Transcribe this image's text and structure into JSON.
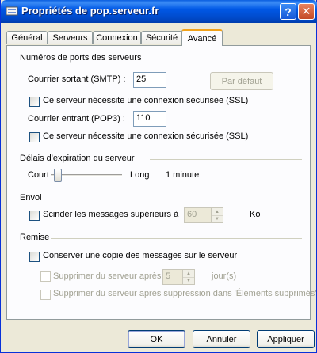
{
  "window": {
    "title": "Propriétés de pop.serveur.fr",
    "help_label": "?",
    "close_label": "✕"
  },
  "tabs": [
    {
      "label": "Général"
    },
    {
      "label": "Serveurs"
    },
    {
      "label": "Connexion"
    },
    {
      "label": "Sécurité"
    },
    {
      "label": "Avancé"
    }
  ],
  "ports": {
    "title": "Numéros de ports des serveurs",
    "smtp_label": "Courrier sortant (SMTP) :",
    "smtp_value": "25",
    "default_button": "Par défaut",
    "smtp_ssl_label": "Ce serveur nécessite une connexion sécurisée (SSL)",
    "pop3_label": "Courrier entrant (POP3) :",
    "pop3_value": "110",
    "pop3_ssl_label": "Ce serveur nécessite une connexion sécurisée (SSL)"
  },
  "timeout": {
    "title": "Délais d'expiration du serveur",
    "short_label": "Court",
    "long_label": "Long",
    "value_label": "1 minute",
    "slider_level": 0.05
  },
  "send": {
    "title": "Envoi",
    "split_label": "Scinder les messages supérieurs à",
    "split_value": "60",
    "unit_label": "Ko"
  },
  "delivery": {
    "title": "Remise",
    "keep_copy_label": "Conserver une copie des messages sur le serveur",
    "remove_after_label": "Supprimer du serveur après",
    "remove_after_value": "5",
    "days_label": "jour(s)",
    "remove_deleted_label": "Supprimer du serveur après suppression dans 'Éléments supprimés'"
  },
  "footer": {
    "ok_label": "OK",
    "cancel_label": "Annuler",
    "apply_label": "Appliquer"
  }
}
